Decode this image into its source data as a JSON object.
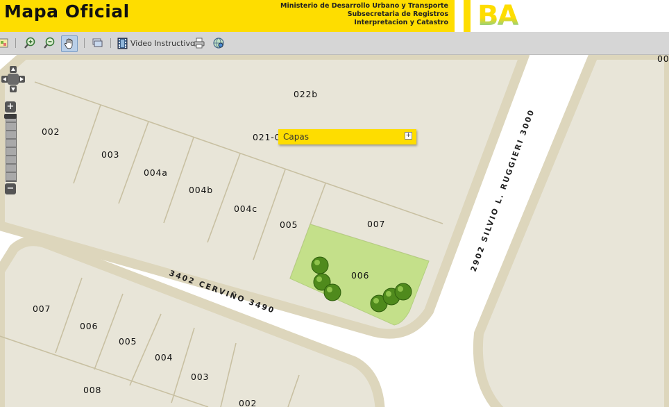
{
  "header": {
    "title": "Mapa Oficial",
    "ministry_lines": [
      "Ministerio de Desarrollo Urbano y Transporte",
      "Subsecretaria de Registros",
      "Interpretacion y Catastro"
    ],
    "logo_text": "BA",
    "colors": {
      "brand_yellow": "#fedd00"
    }
  },
  "toolbar": {
    "tools": [
      {
        "name": "legend-tool",
        "icon": "map-legend-icon"
      },
      {
        "name": "zoom-in-tool",
        "icon": "zoom-in-icon"
      },
      {
        "name": "zoom-out-tool",
        "icon": "zoom-out-icon"
      },
      {
        "name": "pan-tool",
        "icon": "hand-icon",
        "active": true
      },
      {
        "name": "layers-tool",
        "icon": "layers-icon"
      },
      {
        "name": "video-tool",
        "icon": "film-icon"
      },
      {
        "name": "print-tool",
        "icon": "printer-icon"
      },
      {
        "name": "export-tool",
        "icon": "globe-icon"
      }
    ],
    "video_label": "Video Instructivo"
  },
  "map": {
    "block_labels": [
      "022b",
      "021-0"
    ],
    "lot_labels_upper": [
      "002",
      "003",
      "004a",
      "004b",
      "004c",
      "005",
      "007",
      "006"
    ],
    "lot_labels_lower": [
      "007",
      "006",
      "005",
      "004",
      "003",
      "008",
      "002"
    ],
    "streets": [
      "3402 CERVIÑO 3490",
      "2902 SILVIO L. RUGGIERI 3000"
    ],
    "corner_label": "00",
    "highlighted_lot": "006",
    "colors": {
      "block": "#e9e6da",
      "sidewalk": "#ddd6bc",
      "highlight": "#c4e08a",
      "tree": "#4f8a1c"
    }
  },
  "controls": {
    "zoom_in": "+",
    "zoom_out": "−"
  },
  "layers_panel": {
    "label": "Capas",
    "expand": "+"
  }
}
